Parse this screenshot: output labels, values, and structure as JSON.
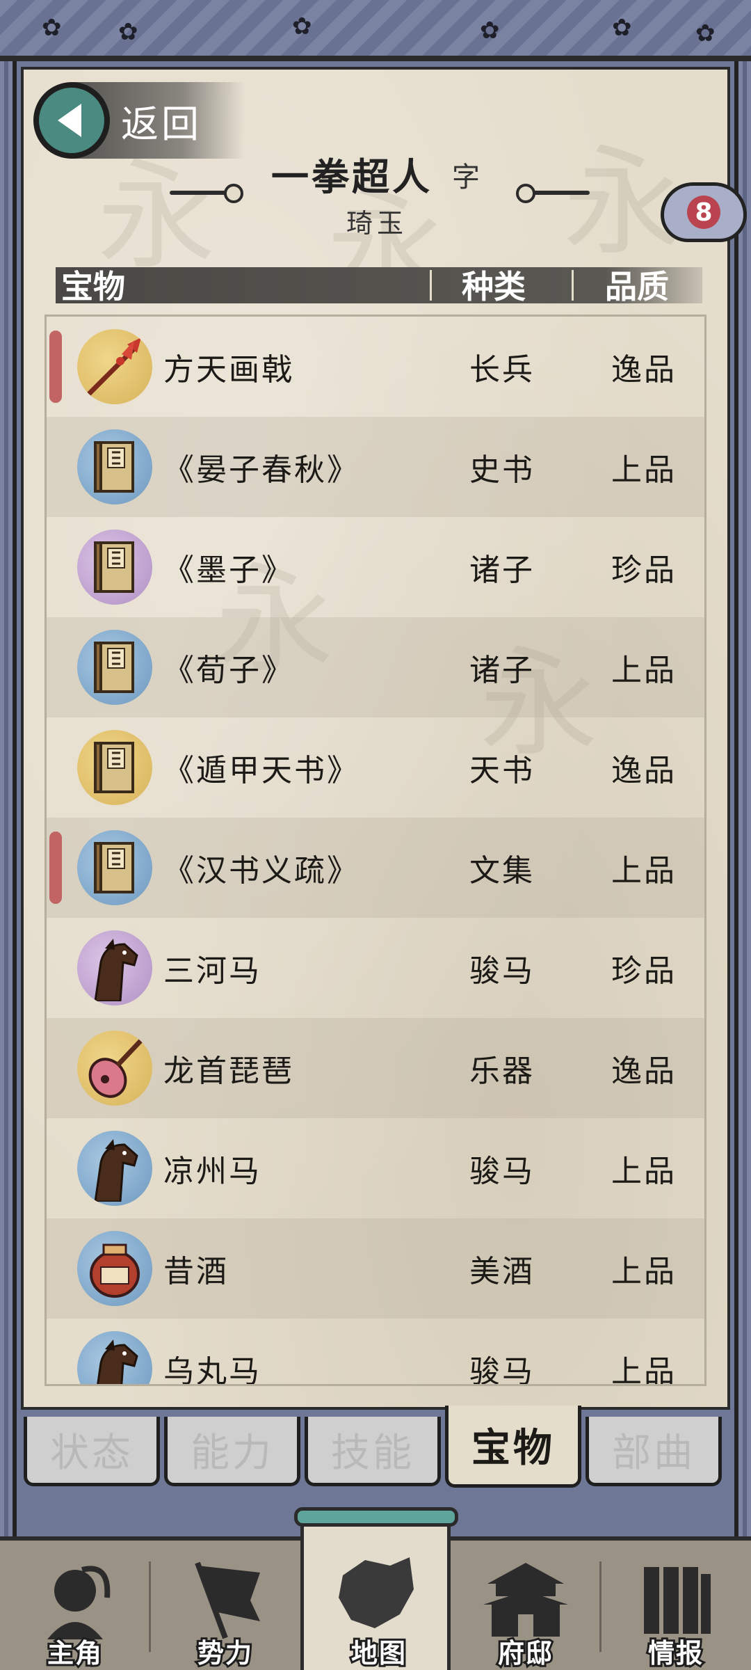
{
  "header": {
    "back_label": "返回",
    "character_name": "一拳超人",
    "zi_label": "字",
    "courtesy_name": "琦玉",
    "badge_count": "8"
  },
  "table": {
    "columns": [
      "宝物",
      "种类",
      "品质"
    ],
    "rows": [
      {
        "name": "方天画戟",
        "type": "长兵",
        "quality": "逸品",
        "icon": "halberd-icon",
        "icon_bg": "gold",
        "marked": true
      },
      {
        "name": "《晏子春秋》",
        "type": "史书",
        "quality": "上品",
        "icon": "book-icon",
        "icon_bg": "blue",
        "marked": false
      },
      {
        "name": "《墨子》",
        "type": "诸子",
        "quality": "珍品",
        "icon": "book-icon",
        "icon_bg": "purple",
        "marked": false
      },
      {
        "name": "《荀子》",
        "type": "诸子",
        "quality": "上品",
        "icon": "book-icon",
        "icon_bg": "blue",
        "marked": false
      },
      {
        "name": "《遁甲天书》",
        "type": "天书",
        "quality": "逸品",
        "icon": "book-icon",
        "icon_bg": "gold",
        "marked": false
      },
      {
        "name": "《汉书义疏》",
        "type": "文集",
        "quality": "上品",
        "icon": "book-icon",
        "icon_bg": "blue",
        "marked": true
      },
      {
        "name": "三河马",
        "type": "骏马",
        "quality": "珍品",
        "icon": "horse-icon",
        "icon_bg": "purple",
        "marked": false
      },
      {
        "name": "龙首琵琶",
        "type": "乐器",
        "quality": "逸品",
        "icon": "pipa-icon",
        "icon_bg": "gold",
        "marked": false
      },
      {
        "name": "凉州马",
        "type": "骏马",
        "quality": "上品",
        "icon": "horse-icon",
        "icon_bg": "blue",
        "marked": false
      },
      {
        "name": "昔酒",
        "type": "美酒",
        "quality": "上品",
        "icon": "wine-jar-icon",
        "icon_bg": "blue",
        "marked": false
      },
      {
        "name": "乌丸马",
        "type": "骏马",
        "quality": "上品",
        "icon": "horse-icon",
        "icon_bg": "blue",
        "marked": false
      }
    ]
  },
  "tabs": [
    {
      "label": "状态",
      "active": false
    },
    {
      "label": "能力",
      "active": false
    },
    {
      "label": "技能",
      "active": false
    },
    {
      "label": "宝物",
      "active": true
    },
    {
      "label": "部曲",
      "active": false
    }
  ],
  "bottom_nav": [
    {
      "label": "主角",
      "icon": "warrior-icon",
      "active": false
    },
    {
      "label": "势力",
      "icon": "banner-flag-icon",
      "active": false
    },
    {
      "label": "地图",
      "icon": "map-icon",
      "active": true
    },
    {
      "label": "府邸",
      "icon": "palace-icon",
      "active": false
    },
    {
      "label": "情报",
      "icon": "scrolls-icon",
      "active": false
    }
  ],
  "colors": {
    "frame": "#6f7796",
    "paper": "#e5ddcc",
    "accent_teal": "#4a8a80",
    "mark_red": "#c26464",
    "badge_red": "#b9434f"
  }
}
